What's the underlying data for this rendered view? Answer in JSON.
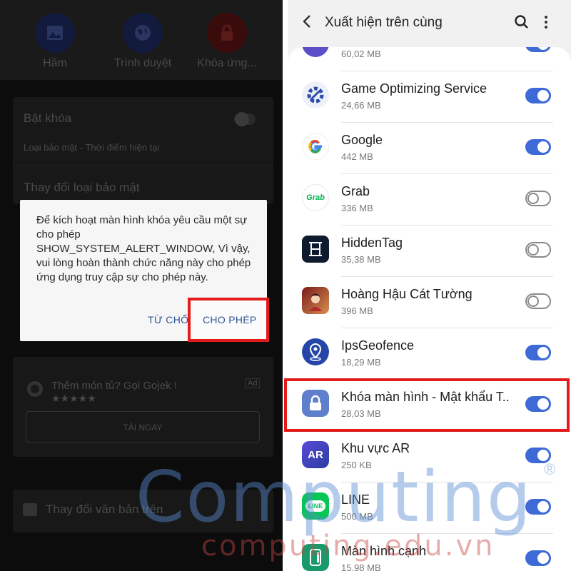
{
  "left": {
    "shortcuts": [
      {
        "label": "Hầm",
        "icon": "image-icon",
        "color": "#121a3d"
      },
      {
        "label": "Trình duyệt",
        "icon": "globe-icon",
        "color": "#121a3d"
      },
      {
        "label": "Khóa ứng...",
        "icon": "lock-icon",
        "color": "#3a0b0b"
      }
    ],
    "lock_toggle_label": "Bật khóa",
    "security_type_label": "Loại bảo mật - Thời điểm hiện tại",
    "change_security_label": "Thay đổi loại bảo mật",
    "ad_text": "Thêm món tủ? Gọi Gojek !",
    "ad_rating": "★★★★★",
    "ad_badge": "Ad",
    "ad_button": "TẢI NGAY",
    "change_text_label": "Thay đổi văn bản trên",
    "dialog": {
      "message": "Để kích hoạt màn hình khóa yêu cầu một sự cho phép SHOW_SYSTEM_ALERT_WINDOW, Vì vậy, vui lòng hoàn thành chức năng này cho phép ứng dụng truy cập sự cho phép này.",
      "deny": "TỪ CHỐI",
      "allow": "CHO PHÉP"
    }
  },
  "right": {
    "title": "Xuất hiện trên cùng",
    "apps": [
      {
        "name": "",
        "size": "60,02 MB",
        "on": true,
        "icon": "partial-app-icon"
      },
      {
        "name": "Game Optimizing Service",
        "size": "24,66 MB",
        "on": true,
        "icon": "game-optimizing-icon"
      },
      {
        "name": "Google",
        "size": "442 MB",
        "on": true,
        "icon": "google-icon"
      },
      {
        "name": "Grab",
        "size": "336 MB",
        "on": false,
        "icon": "grab-icon"
      },
      {
        "name": "HiddenTag",
        "size": "35,38 MB",
        "on": false,
        "icon": "hiddentag-icon"
      },
      {
        "name": "Hoàng Hậu Cát Tường",
        "size": "396 MB",
        "on": false,
        "icon": "game-portrait-icon"
      },
      {
        "name": "IpsGeofence",
        "size": "18,29 MB",
        "on": true,
        "icon": "geofence-icon"
      },
      {
        "name": "Khóa màn hình - Mật khẩu T..",
        "size": "28,03 MB",
        "on": true,
        "icon": "screen-lock-icon"
      },
      {
        "name": "Khu vực AR",
        "size": "250 KB",
        "on": true,
        "icon": "ar-zone-icon"
      },
      {
        "name": "LINE",
        "size": "500 MB",
        "on": true,
        "icon": "line-icon"
      },
      {
        "name": "Màn hình cạnh",
        "size": "15,98 MB",
        "on": true,
        "icon": "edge-screen-icon"
      }
    ]
  },
  "watermark": {
    "brand": "Computing",
    "site": "computing.edu.vn",
    "reg": "®"
  }
}
